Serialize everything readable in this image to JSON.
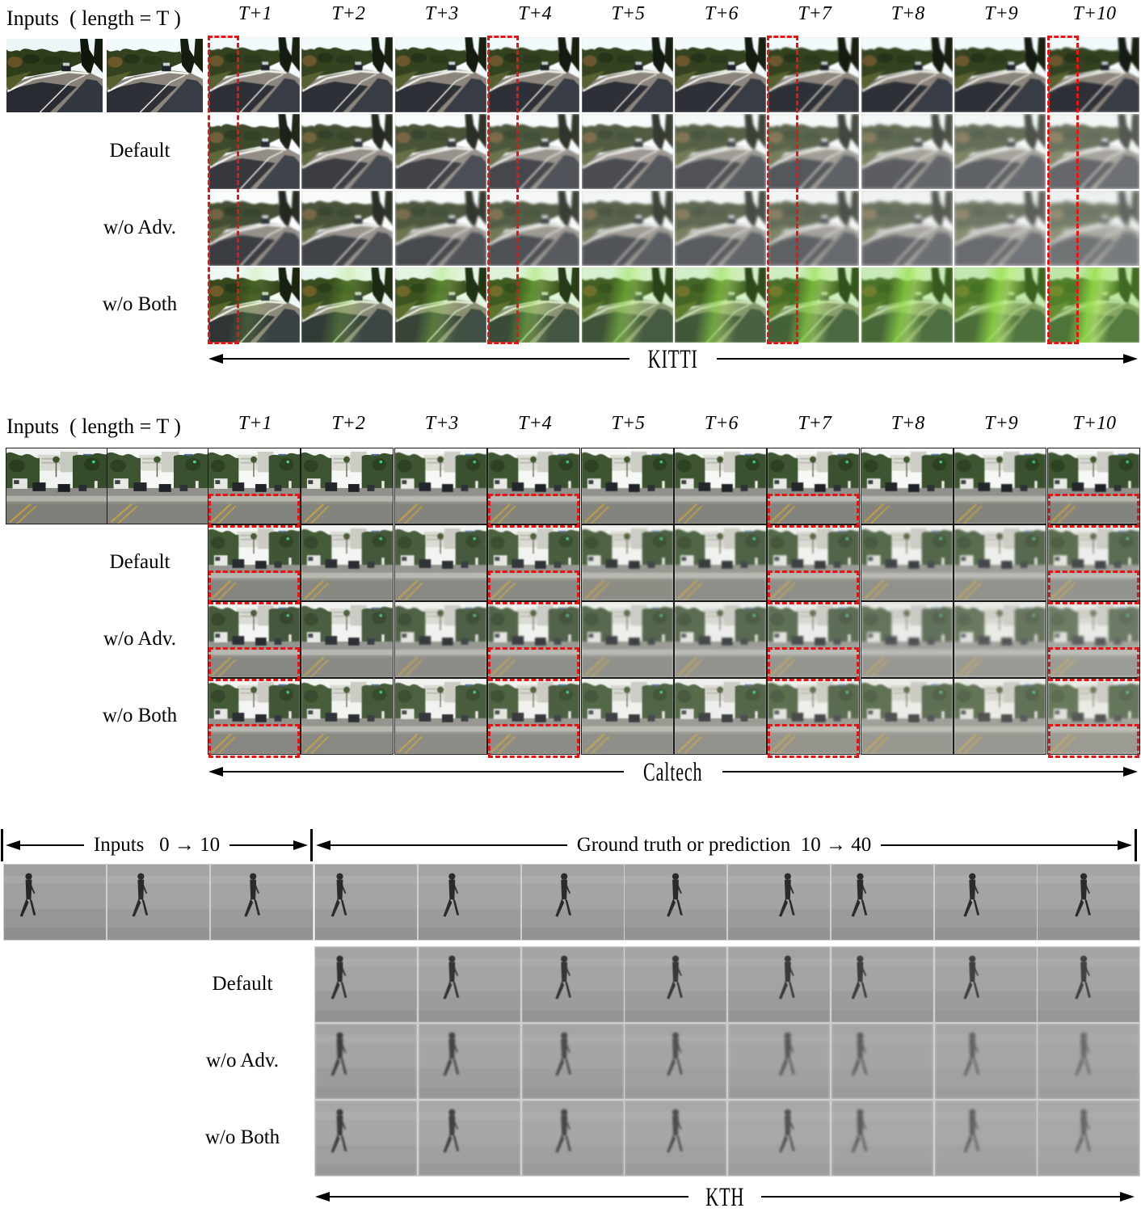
{
  "figure": {
    "accent_red": "#e81313",
    "sections": [
      {
        "id": "kitti",
        "dataset_label": "KITTI",
        "inputs_label": "Inputs  ( length = T )",
        "column_headers": [
          "T+1",
          "T+2",
          "T+3",
          "T+4",
          "T+5",
          "T+6",
          "T+7",
          "T+8",
          "T+9",
          "T+10"
        ],
        "row_labels": [
          "Default",
          "w/o Adv.",
          "w/o Both"
        ],
        "num_input_frames": 2,
        "num_predicted_frames": 10,
        "highlighted_steps": [
          "T+1",
          "T+4",
          "T+7",
          "T+10"
        ]
      },
      {
        "id": "caltech",
        "dataset_label": "Caltech",
        "inputs_label": "Inputs  ( length = T )",
        "column_headers": [
          "T+1",
          "T+2",
          "T+3",
          "T+4",
          "T+5",
          "T+6",
          "T+7",
          "T+8",
          "T+9",
          "T+10"
        ],
        "row_labels": [
          "Default",
          "w/o Adv.",
          "w/o Both"
        ],
        "num_input_frames": 2,
        "num_predicted_frames": 10,
        "highlighted_steps": [
          "T+1",
          "T+4",
          "T+7",
          "T+10"
        ]
      },
      {
        "id": "kth",
        "dataset_label": "KTH",
        "inputs_arrow_label": "Inputs   0 → 10",
        "prediction_arrow_label": "Ground truth or prediction  10 → 40",
        "row_labels": [
          "Default",
          "w/o Adv.",
          "w/o Both"
        ],
        "num_input_frames": 3,
        "num_frames_per_row": 8
      }
    ]
  }
}
